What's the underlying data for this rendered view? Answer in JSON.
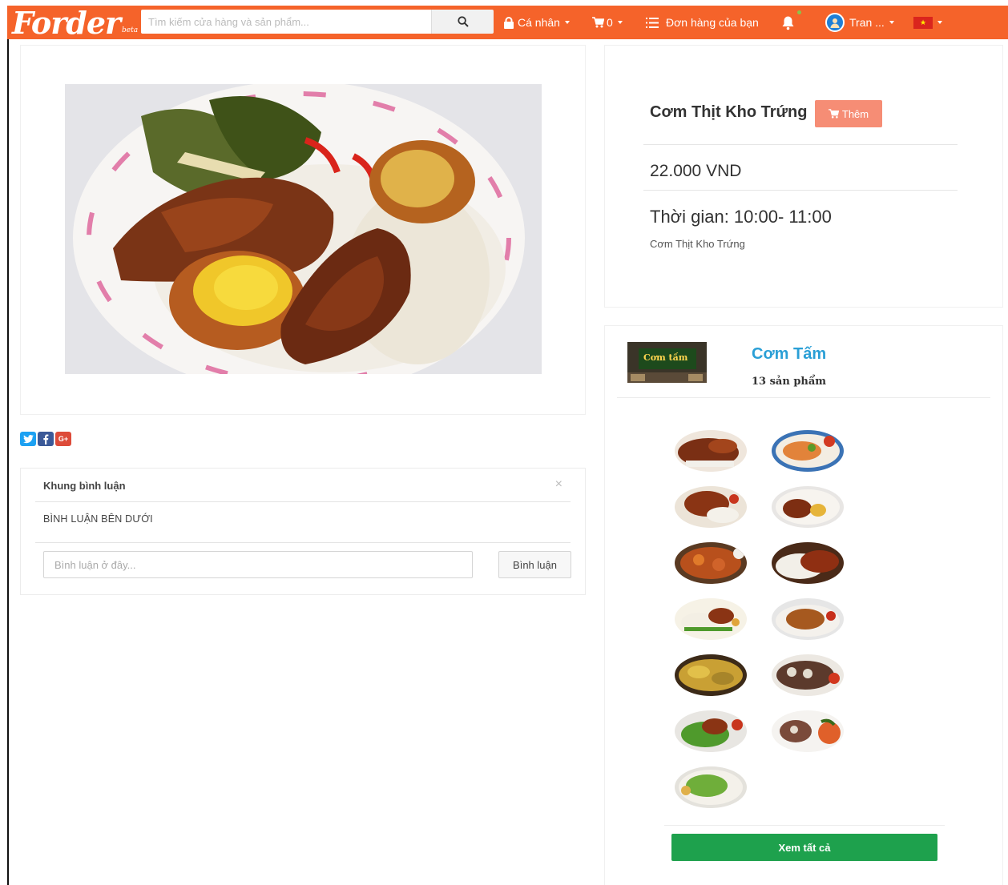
{
  "navbar": {
    "logo": "Forder",
    "logo_beta": "beta",
    "search_placeholder": "Tìm kiếm cửa hàng và sản phẩm...",
    "personal_label": "Cá nhân",
    "cart_count": "0",
    "orders_label": "Đơn hàng của bạn",
    "user_label": "Tran ...",
    "bg_color": "#f5632a"
  },
  "share": {
    "twitter_icon": "twitter-icon",
    "facebook_icon": "facebook-icon",
    "google_plus_label": "G+"
  },
  "comments": {
    "title": "Khung bình luận",
    "close_label": "×",
    "section_label": "BÌNH LUẬN BÊN DƯỚI",
    "input_placeholder": "Bình luận ở đây...",
    "submit_label": "Bình luận"
  },
  "product": {
    "name": "Cơm Thịt Kho Trứng",
    "add_label": "Thêm",
    "price": "22.000 VND",
    "time": "Thời gian: 10:00- 11:00",
    "description": "Cơm Thịt Kho Trứng",
    "add_button_color": "#f68d75"
  },
  "store": {
    "logo_text": "Cơm tấm",
    "name": "Cơm Tấm",
    "product_count": "13 sản phẩm",
    "view_all_label": "Xem tất cả",
    "name_color": "#2a9fd6",
    "view_all_color": "#1ea14d"
  }
}
